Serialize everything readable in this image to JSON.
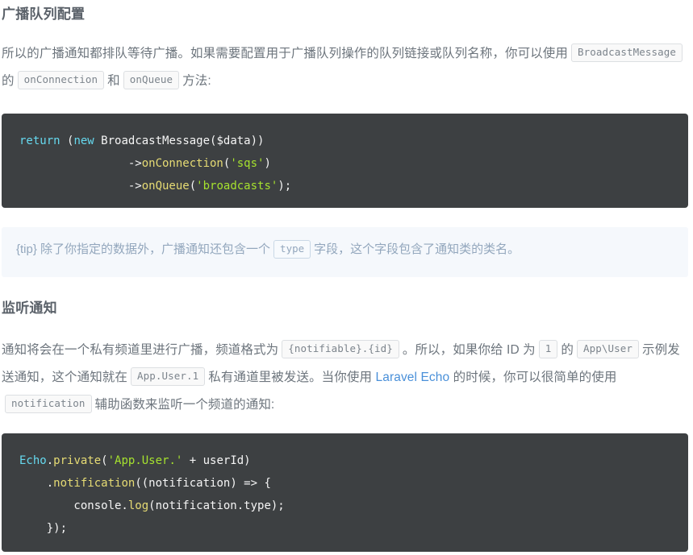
{
  "doc": {
    "sections": [
      {
        "id": "broadcast-queue-config",
        "title": "广播队列配置",
        "paragraph": {
          "part1": "所以的广播通知都排队等待广播。如果需要配置用于广播队列操作的队列链接或队列名称，你可以使用",
          "code1": "BroadcastMessage",
          "part2": "的",
          "code2": "onConnection",
          "part3": "和",
          "code3": "onQueue",
          "part4": "方法:"
        },
        "code_block": {
          "language": "php",
          "lines": [
            {
              "tokens": [
                {
                  "text": "return ",
                  "type": "keyword"
                },
                {
                  "text": "(",
                  "type": "plain"
                },
                {
                  "text": "new ",
                  "type": "keyword"
                },
                {
                  "text": "BroadcastMessage($data))",
                  "type": "plain"
                }
              ]
            },
            {
              "tokens": [
                {
                  "text": "                ->",
                  "type": "plain"
                },
                {
                  "text": "onConnection",
                  "type": "function"
                },
                {
                  "text": "(",
                  "type": "plain"
                },
                {
                  "text": "'sqs'",
                  "type": "string"
                },
                {
                  "text": ")",
                  "type": "plain"
                }
              ]
            },
            {
              "tokens": [
                {
                  "text": "                ->",
                  "type": "plain"
                },
                {
                  "text": "onQueue",
                  "type": "function"
                },
                {
                  "text": "(",
                  "type": "plain"
                },
                {
                  "text": "'broadcasts'",
                  "type": "string"
                },
                {
                  "text": ");",
                  "type": "plain"
                }
              ]
            }
          ]
        },
        "tip": {
          "part1": "{tip} 除了你指定的数据外，广播通知还包含一个",
          "code1": "type",
          "part2": "字段，这个字段包含了通知类的类名。"
        }
      },
      {
        "id": "listen-notification",
        "title": "监听通知",
        "paragraph": {
          "part1": "通知将会在一个私有频道里进行广播，频道格式为",
          "code1": "{notifiable}.{id}",
          "part2": "。所以，如果你给 ID 为",
          "code2": "1",
          "part3": "的",
          "code3": "App\\User",
          "part4": "示例发送通知，这个通知就在",
          "code4": "App.User.1",
          "part5": "私有通道里被发送。当你使用",
          "link_text": "Laravel Echo",
          "part6": "的时候，你可以很简单的使用",
          "code5": "notification",
          "part7": "辅助函数来监听一个频道的通知:"
        },
        "code_block": {
          "language": "javascript",
          "lines": [
            {
              "tokens": [
                {
                  "text": "Echo",
                  "type": "keyword"
                },
                {
                  "text": ".",
                  "type": "plain"
                },
                {
                  "text": "private",
                  "type": "function"
                },
                {
                  "text": "(",
                  "type": "plain"
                },
                {
                  "text": "'App.User.'",
                  "type": "string"
                },
                {
                  "text": " + userId)",
                  "type": "plain"
                }
              ]
            },
            {
              "tokens": [
                {
                  "text": "    .",
                  "type": "plain"
                },
                {
                  "text": "notification",
                  "type": "function"
                },
                {
                  "text": "((notification) => {",
                  "type": "plain"
                }
              ]
            },
            {
              "tokens": [
                {
                  "text": "        console.",
                  "type": "plain"
                },
                {
                  "text": "log",
                  "type": "function"
                },
                {
                  "text": "(notification.type);",
                  "type": "plain"
                }
              ]
            },
            {
              "tokens": [
                {
                  "text": "    });",
                  "type": "plain"
                }
              ]
            }
          ]
        }
      }
    ]
  },
  "colors": {
    "page_background": "#ffffff",
    "heading": "#5a6169",
    "body_text": "#6d757d",
    "link": "#4a90d9",
    "code_background": "#3d4042",
    "code_keyword": "#66d9ef",
    "code_function": "#e6db74",
    "code_string": "#a6e22e",
    "code_plain": "#f5f5f5",
    "inline_code_background": "#f9f9f9",
    "inline_code_border": "#dcdfe2",
    "tip_background": "#f5f8fc",
    "tip_text": "#93a7bd"
  }
}
